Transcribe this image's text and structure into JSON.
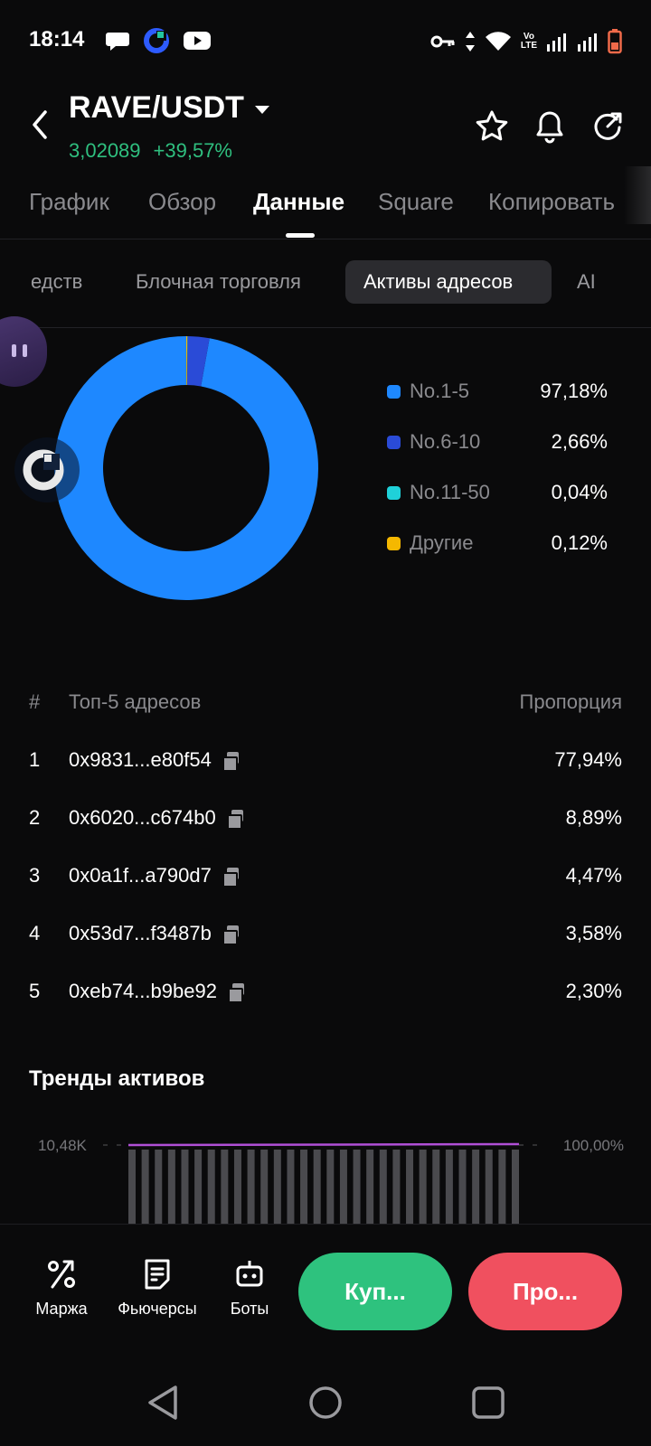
{
  "status_bar": {
    "time": "18:14",
    "volte_top": "Vo",
    "volte_bottom": "LTE"
  },
  "header": {
    "pair": "RAVE/USDT",
    "price": "3,02089",
    "change": "+39,57%"
  },
  "tabs": [
    {
      "label": "График"
    },
    {
      "label": "Обзор"
    },
    {
      "label": "Данные"
    },
    {
      "label": "Square"
    },
    {
      "label": "Копировать"
    }
  ],
  "subtabs": [
    {
      "label": "едств"
    },
    {
      "label": "Блочная торговля"
    },
    {
      "label": "Активы адресов"
    },
    {
      "label": "AI"
    }
  ],
  "chart_data": {
    "type": "pie",
    "series": [
      {
        "name": "No.1-5",
        "value": 97.18,
        "label": "97,18%",
        "color": "#1e88ff"
      },
      {
        "name": "No.6-10",
        "value": 2.66,
        "label": "2,66%",
        "color": "#2a4bd7"
      },
      {
        "name": "No.11-50",
        "value": 0.04,
        "label": "0,04%",
        "color": "#1fd1d9"
      },
      {
        "name": "Другие",
        "value": 0.12,
        "label": "0,12%",
        "color": "#f5b800"
      }
    ]
  },
  "table": {
    "col_index": "#",
    "col_address": "Топ-5 адресов",
    "col_proportion": "Пропорция",
    "rows": [
      {
        "index": "1",
        "address": "0x9831...e80f54",
        "proportion": "77,94%"
      },
      {
        "index": "2",
        "address": "0x6020...c674b0",
        "proportion": "8,89%"
      },
      {
        "index": "3",
        "address": "0x0a1f...a790d7",
        "proportion": "4,47%"
      },
      {
        "index": "4",
        "address": "0x53d7...f3487b",
        "proportion": "3,58%"
      },
      {
        "index": "5",
        "address": "0xeb74...b9be92",
        "proportion": "2,30%"
      }
    ]
  },
  "trends": {
    "title": "Тренды активов",
    "left_axis_top": "10,48K",
    "right_axis_top": "100,00%",
    "bar_count": 30
  },
  "bottom_bar": {
    "margin_label": "Маржа",
    "futures_label": "Фьючерсы",
    "bots_label": "Боты",
    "buy_label": "Куп...",
    "sell_label": "Про..."
  },
  "colors": {
    "accent_green": "#2fbf7f",
    "buy": "#2ec27e",
    "sell": "#f0505f"
  }
}
